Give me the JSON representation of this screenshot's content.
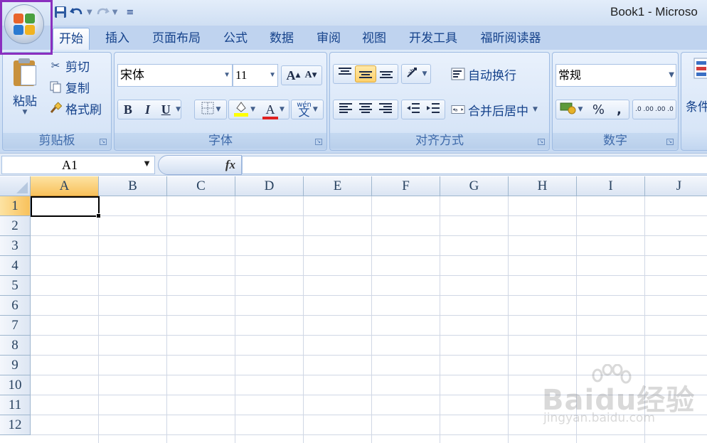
{
  "window": {
    "title": "Book1 - Microso"
  },
  "quick_access": {
    "save": "save-icon",
    "undo": "undo-icon",
    "redo": "redo-icon",
    "customize": "customize-icon"
  },
  "tabs": [
    {
      "label": "开始",
      "active": true
    },
    {
      "label": "插入"
    },
    {
      "label": "页面布局"
    },
    {
      "label": "公式"
    },
    {
      "label": "数据"
    },
    {
      "label": "审阅"
    },
    {
      "label": "视图"
    },
    {
      "label": "开发工具"
    },
    {
      "label": "福昕阅读器"
    }
  ],
  "ribbon": {
    "clipboard": {
      "label": "剪贴板",
      "paste": "粘贴",
      "cut": "剪切",
      "copy": "复制",
      "format_painter": "格式刷"
    },
    "font": {
      "label": "字体",
      "font_name": "宋体",
      "font_size": "11",
      "bold": "B",
      "italic": "I",
      "underline": "U",
      "font_color_glyph": "A",
      "grow": "A",
      "shrink": "A",
      "phonetic": "wén"
    },
    "alignment": {
      "label": "对齐方式",
      "wrap_text": "自动换行",
      "merge_center": "合并后居中"
    },
    "number": {
      "label": "数字",
      "format": "常规",
      "percent": "%",
      "comma": ",",
      "inc_decimal": ".0 .00",
      "dec_decimal": ".00 .0"
    },
    "styles": {
      "conditional": "条件"
    }
  },
  "formula_bar": {
    "name_box": "A1",
    "fx": "fx",
    "value": ""
  },
  "sheet": {
    "columns": [
      "A",
      "B",
      "C",
      "D",
      "E",
      "F",
      "G",
      "H",
      "I",
      "J"
    ],
    "rows": [
      "1",
      "2",
      "3",
      "4",
      "5",
      "6",
      "7",
      "8",
      "9",
      "10",
      "11",
      "12"
    ],
    "active_cell": "A1"
  },
  "watermark": {
    "brand": "Baidu经验",
    "url": "jingyan.baidu.com"
  },
  "colors": {
    "accent": "#8a2fbf",
    "ribbon": "#dde9f8",
    "selected_header": "#f8c15b",
    "text": "#15428b"
  }
}
